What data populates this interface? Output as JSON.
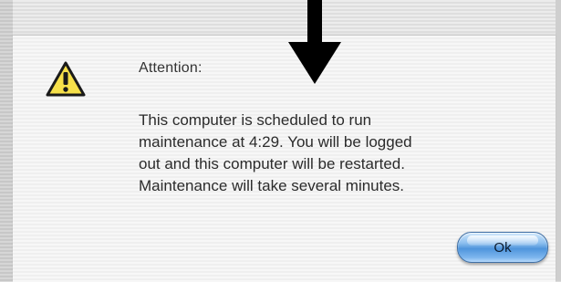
{
  "dialog": {
    "heading": "Attention:",
    "message_lines": [
      "This computer is scheduled to run",
      "maintenance at 4:29. You will be logged",
      "out and this computer will be restarted.",
      "Maintenance will take several minutes."
    ],
    "ok_label": "Ok",
    "icon": "warning-triangle-icon"
  },
  "annotation": {
    "icon": "down-arrow-icon"
  },
  "colors": {
    "button_blue": "#4f95dc",
    "warning_yellow": "#f6e04a",
    "arrow_black": "#000000"
  }
}
